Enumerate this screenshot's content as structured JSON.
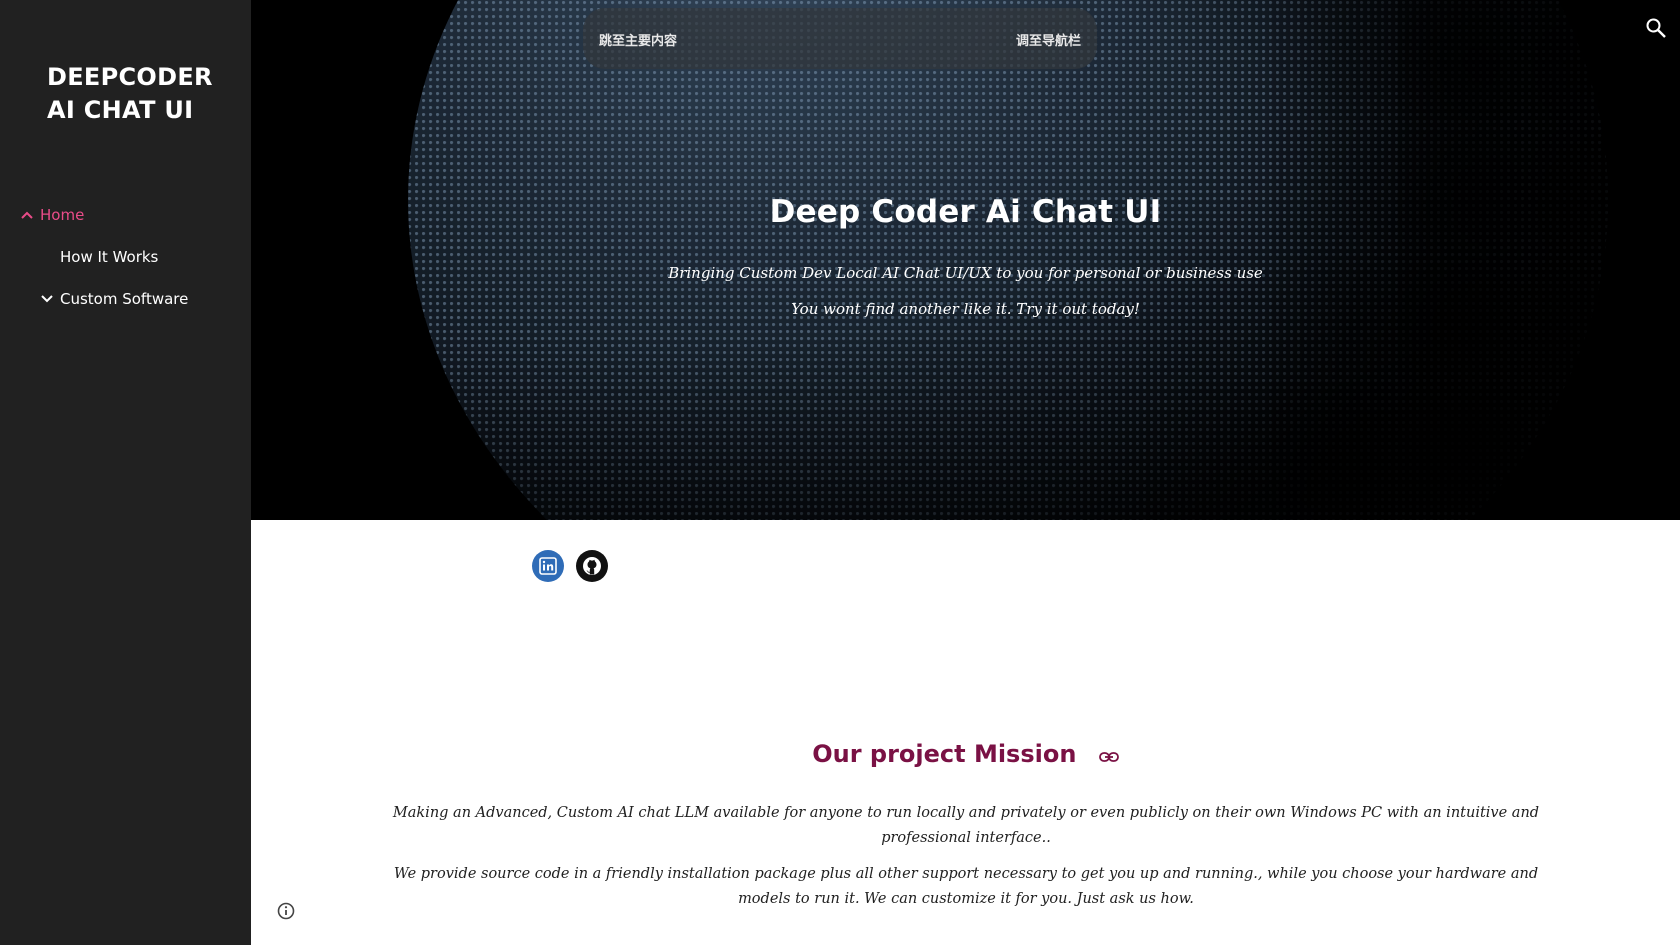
{
  "sidebar": {
    "site_title_line1": "DEEPCODER",
    "site_title_line2": "AI CHAT UI",
    "items": [
      {
        "label": "Home",
        "icon": "chevron-up-icon",
        "active": true
      },
      {
        "label": "How It Works"
      },
      {
        "label": "Custom Software",
        "icon": "chevron-down-icon"
      }
    ],
    "active_color": "#ea4c89",
    "background": "#212121"
  },
  "hero": {
    "skip_main": "跳至主要内容",
    "skip_nav": "调至导航栏",
    "title": "Deep Coder Ai Chat UI",
    "subtitle_line1": "Bringing Custom Dev Local AI Chat UI/UX  to you for personal or business use",
    "subtitle_line2": "You wont find another like it. Try it out today!",
    "search_icon": "search-icon"
  },
  "social": {
    "items": [
      {
        "name": "linkedin-icon",
        "color": "#2f6cb7"
      },
      {
        "name": "github-icon",
        "color": "#111111"
      }
    ]
  },
  "mission": {
    "title": "Our project Mission",
    "title_color": "#7a1144",
    "paragraph1": "Making an Advanced, Custom AI chat LLM available for anyone to run locally and privately or even publicly on their own Windows PC with an intuitive and professional interface..",
    "paragraph2": "We provide source code in a friendly installation package  plus all other support necessary to get you up and running., while you choose your hardware  and models to run it. We can customize it for you. Just ask us how."
  }
}
